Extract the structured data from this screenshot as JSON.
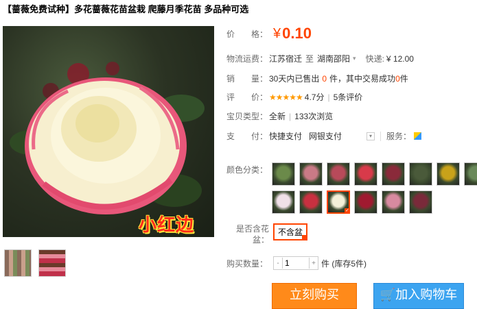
{
  "title": "【蔷薇免费试种】多花蔷薇花苗盆栽 爬藤月季花苗 多品种可选",
  "image": {
    "overlay_text": "小红边"
  },
  "price": {
    "label": "价　　格：",
    "symbol": "¥",
    "value": "0.10"
  },
  "shipping": {
    "label": "物流运费：",
    "from": "江苏宿迁",
    "sep": "至",
    "to": "湖南邵阳",
    "fee_label": "快递:",
    "fee": "¥ 12.00"
  },
  "sales": {
    "label": "销　　量：",
    "pre": "30天内已售出",
    "count": "0",
    "mid": "件，其中交易成功",
    "success": "0",
    "suffix": "件"
  },
  "rating": {
    "label": "评　　价：",
    "stars": "★★★★★",
    "score": "4.7分",
    "reviews": "5条评价"
  },
  "category": {
    "label": "宝贝类型：",
    "type": "全新",
    "views": "133次浏览"
  },
  "payment": {
    "label": "支　　付：",
    "method1": "快捷支付",
    "method2": "网银支付",
    "service_label": "服务："
  },
  "color_label": "颜色分类：",
  "pot": {
    "label": "是否含花盆：",
    "option": "不含盆"
  },
  "quantity": {
    "label": "购买数量：",
    "value": "1",
    "unit": "件 (库存5件)",
    "minus": "-",
    "plus": "+"
  },
  "buttons": {
    "buy": "立刻购买",
    "cart": "加入购物车"
  },
  "colors": {
    "swatches": [
      "#6b8a4a",
      "#c97a86",
      "#b84a5a",
      "#d83a4a",
      "#8a2a3a",
      "#4a5a3a",
      "#c8a21a",
      "#6a8a5a",
      "#f0e0e8",
      "#c83040",
      "#f4f0d8",
      "#a01a30",
      "#d88aa0",
      "#7a2a3a"
    ]
  }
}
